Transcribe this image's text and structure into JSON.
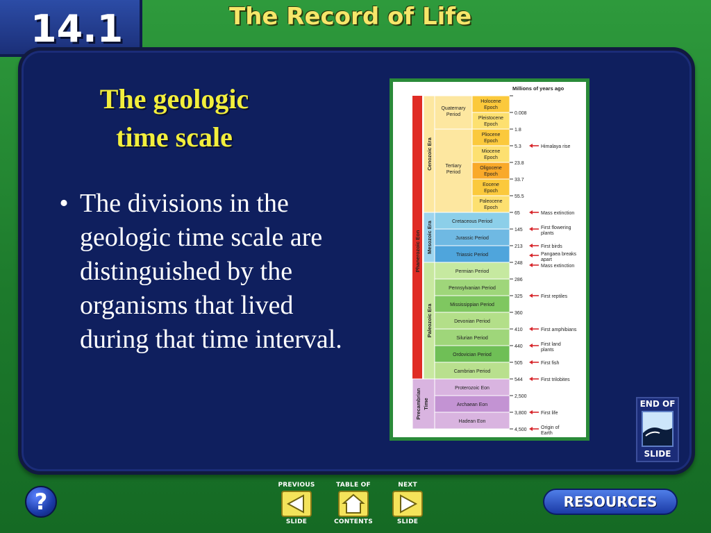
{
  "header": {
    "section_number": "14.1",
    "chapter_title": "The Record of Life"
  },
  "slide": {
    "heading_line1": "The geologic",
    "heading_line2": "time scale",
    "bullet_marker": "•",
    "bullet_text": "The divisions in the geologic time scale are distinguished by the organisms that lived during that time interval."
  },
  "figure": {
    "scale_header": "Millions of years ago",
    "eon_label": "Phanerozoic Eon",
    "precambrian_label_line1": "Precambrian",
    "precambrian_label_line2": "Time",
    "eras": [
      {
        "name": "Cenozoic Era",
        "color": "#fde7a0"
      },
      {
        "name": "Mesozoic Era",
        "color": "#9dd4ee"
      },
      {
        "name": "Paleozoic Era",
        "color": "#c8e8a0"
      }
    ],
    "cenozoic_periods": [
      {
        "name": "Quaternary Period"
      },
      {
        "name": "Tertiary Period"
      }
    ],
    "epochs": [
      {
        "name_line1": "Holocene",
        "name_line2": "Epoch",
        "color": "#fbc93c"
      },
      {
        "name_line1": "Pleistocene",
        "name_line2": "Epoch",
        "color": "#fde070"
      },
      {
        "name_line1": "Pliocene",
        "name_line2": "Epoch",
        "color": "#fbc93c"
      },
      {
        "name_line1": "Miocene",
        "name_line2": "Epoch",
        "color": "#fde070"
      },
      {
        "name_line1": "Oligocene",
        "name_line2": "Epoch",
        "color": "#f9a92a"
      },
      {
        "name_line1": "Eocene",
        "name_line2": "Epoch",
        "color": "#fbc93c"
      },
      {
        "name_line1": "Paleocene",
        "name_line2": "Epoch",
        "color": "#fde070"
      }
    ],
    "periods": [
      {
        "name": "Cretaceous Period",
        "color": "#8ccfe9"
      },
      {
        "name": "Jurassic Period",
        "color": "#6fb9e3"
      },
      {
        "name": "Triassic Period",
        "color": "#4fa5dc"
      },
      {
        "name": "Permian Period",
        "color": "#c6e9a0"
      },
      {
        "name": "Pennsylvanian Period",
        "color": "#9fd67a"
      },
      {
        "name": "Mississippian Period",
        "color": "#7fc760"
      },
      {
        "name": "Devonian Period",
        "color": "#b3df89"
      },
      {
        "name": "Silurian Period",
        "color": "#9fd67a"
      },
      {
        "name": "Ordovician Period",
        "color": "#6fbf56"
      },
      {
        "name": "Cambrian Period",
        "color": "#b9e08e"
      },
      {
        "name": "Proterozoic Eon",
        "color": "#d9b4e0"
      },
      {
        "name": "Archaean Eon",
        "color": "#c393d3"
      },
      {
        "name": "Hadean Eon",
        "color": "#d9b4e0"
      }
    ],
    "ticks": [
      "0.008",
      "1.8",
      "5.3",
      "23.8",
      "33.7",
      "55.5",
      "65",
      "145",
      "213",
      "248",
      "286",
      "325",
      "360",
      "410",
      "440",
      "505",
      "544",
      "2,500",
      "3,800",
      "4,500"
    ],
    "events": [
      {
        "tick": "5.3",
        "label": "Himalaya rise"
      },
      {
        "tick": "65",
        "label": "Mass extinction"
      },
      {
        "tick": "145",
        "label": "First flowering plants"
      },
      {
        "tick": "213",
        "label": "First birds"
      },
      {
        "tick": "248",
        "label": "Pangaea breaks apart"
      },
      {
        "tick": "248",
        "label": "Mass extinction"
      },
      {
        "tick": "325",
        "label": "First reptiles"
      },
      {
        "tick": "410",
        "label": "First amphibians"
      },
      {
        "tick": "440",
        "label": "First land plants"
      },
      {
        "tick": "505",
        "label": "First fish"
      },
      {
        "tick": "544",
        "label": "First trilobites"
      },
      {
        "tick": "3,800",
        "label": "First life"
      },
      {
        "tick": "4,500",
        "label": "Origin of Earth"
      }
    ],
    "colors": {
      "eon_bar": "#e02c25",
      "precambrian": "#d9b4e0",
      "arrow": "#d7262b"
    }
  },
  "footer": {
    "help_label": "?",
    "previous_line1": "PREVIOUS",
    "previous_line2": "SLIDE",
    "toc_line1": "TABLE OF",
    "toc_line2": "CONTENTS",
    "next_line1": "NEXT",
    "next_line2": "SLIDE",
    "resources_label": "RESOURCES",
    "end_slide_line1": "END OF",
    "end_slide_line2": "SLIDE"
  }
}
